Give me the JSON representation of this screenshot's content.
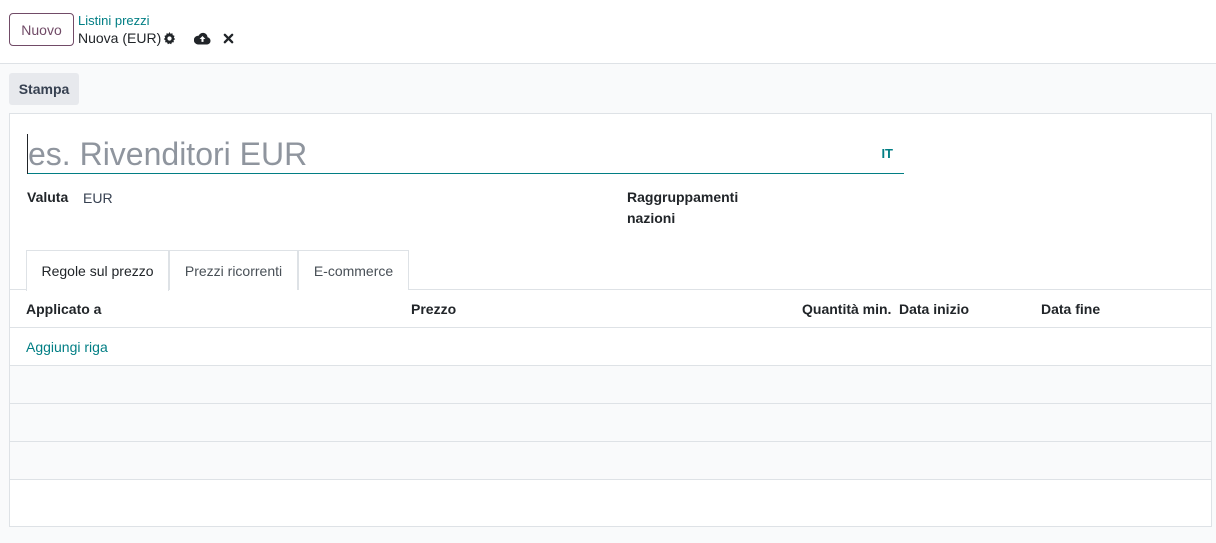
{
  "control_panel": {
    "new_button": "Nuovo",
    "breadcrumb_parent": "Listini prezzi",
    "breadcrumb_current": "Nuova (EUR)",
    "icons": [
      "gear-icon",
      "cloud-upload-icon",
      "close-icon"
    ]
  },
  "actions": {
    "print_label": "Stampa"
  },
  "form": {
    "name_placeholder": "es. Rivenditori EUR",
    "name_value": "",
    "lang_label": "IT",
    "currency_label": "Valuta",
    "currency_value": "EUR",
    "country_groups_label_line1": "Raggruppamenti",
    "country_groups_label_line2": "nazioni"
  },
  "tabs": [
    {
      "label": "Regole sul prezzo",
      "active": true
    },
    {
      "label": "Prezzi ricorrenti",
      "active": false
    },
    {
      "label": "E-commerce",
      "active": false
    }
  ],
  "table": {
    "columns": [
      "Applicato a",
      "Prezzo",
      "Quantità min.",
      "Data inizio",
      "Data fine"
    ],
    "add_line_label": "Aggiungi riga"
  },
  "colors": {
    "brand": "#714b67",
    "accent": "#017e84"
  }
}
